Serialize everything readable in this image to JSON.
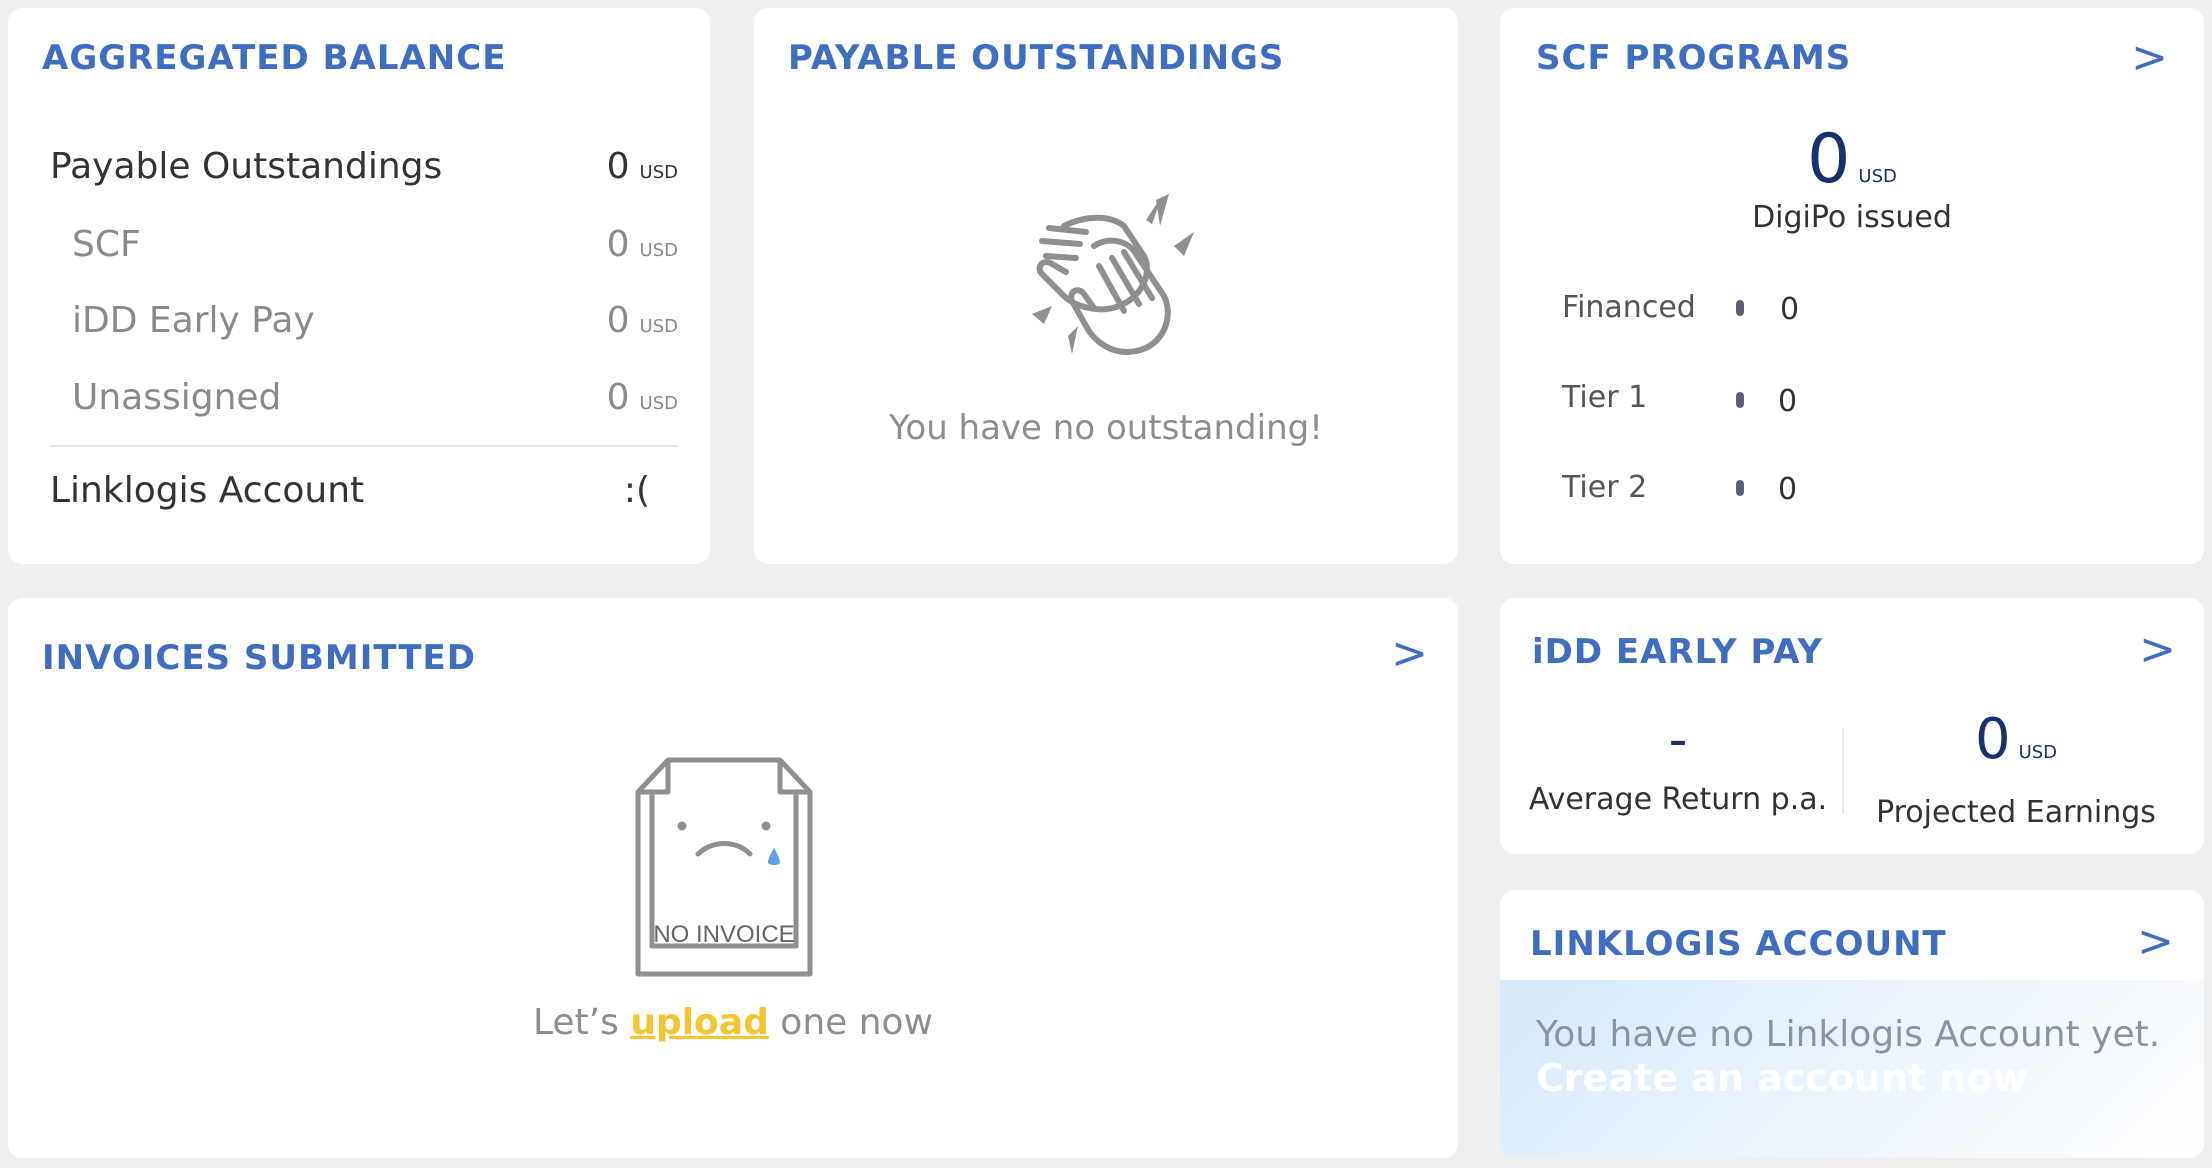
{
  "aggregated": {
    "title": "AGGREGATED BALANCE",
    "rows": [
      {
        "label": "Payable Outstandings",
        "value": "0",
        "unit": "USD"
      },
      {
        "label": "SCF",
        "value": "0",
        "unit": "USD"
      },
      {
        "label": "iDD Early Pay",
        "value": "0",
        "unit": "USD"
      },
      {
        "label": "Unassigned",
        "value": "0",
        "unit": "USD"
      }
    ],
    "linklogis_label": "Linklogis Account",
    "linklogis_value": ":("
  },
  "payable": {
    "title": "PAYABLE OUTSTANDINGS",
    "icon": "clapping-hands-icon",
    "message": "You have no outstanding!"
  },
  "scf": {
    "title": "SCF PROGRAMS",
    "chevron": ">",
    "amount": "0",
    "unit": "USD",
    "caption": "DigiPo issued",
    "rows": [
      {
        "label": "Financed",
        "value": "0"
      },
      {
        "label": "Tier 1",
        "value": "0"
      },
      {
        "label": "Tier 2",
        "value": "0"
      }
    ]
  },
  "invoices": {
    "title": "INVOICES SUBMITTED",
    "chevron": ">",
    "icon": "sad-box-icon",
    "box_label": "NO INVOICE",
    "prefix": "Let’s ",
    "link": "upload",
    "suffix": " one now"
  },
  "idd": {
    "title": "iDD EARLY PAY",
    "chevron": ">",
    "avg_value": "-",
    "avg_label": "Average Return p.a.",
    "earn_value": "0",
    "earn_unit": "USD",
    "earn_label": "Projected Earnings"
  },
  "linklogis": {
    "title": "LINKLOGIS ACCOUNT",
    "chevron": ">",
    "message": "You have no Linklogis Account yet.",
    "cta": "Create an account now"
  },
  "colors": {
    "accent": "#3f6ec1",
    "highlight": "#f4c431",
    "navy": "#1a2f6e"
  }
}
